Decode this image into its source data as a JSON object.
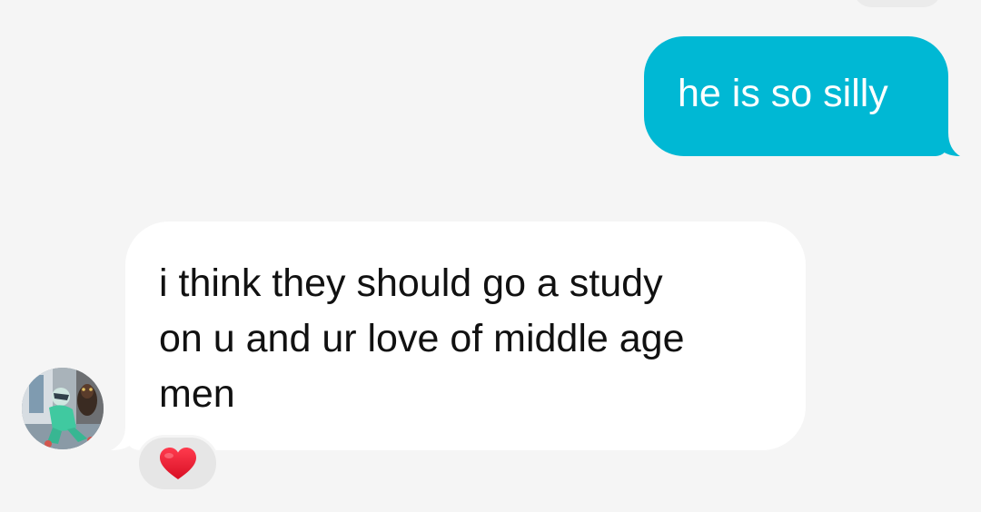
{
  "chat": {
    "outgoing": {
      "text": "he is so silly",
      "color": "#00b8d4"
    },
    "incoming": {
      "lines": [
        "i think they should go a study",
        "on u and ur love of middle age",
        "men"
      ],
      "reaction": "heart-icon",
      "reaction_color": "#e8112d"
    },
    "avatar": "contact-avatar"
  }
}
